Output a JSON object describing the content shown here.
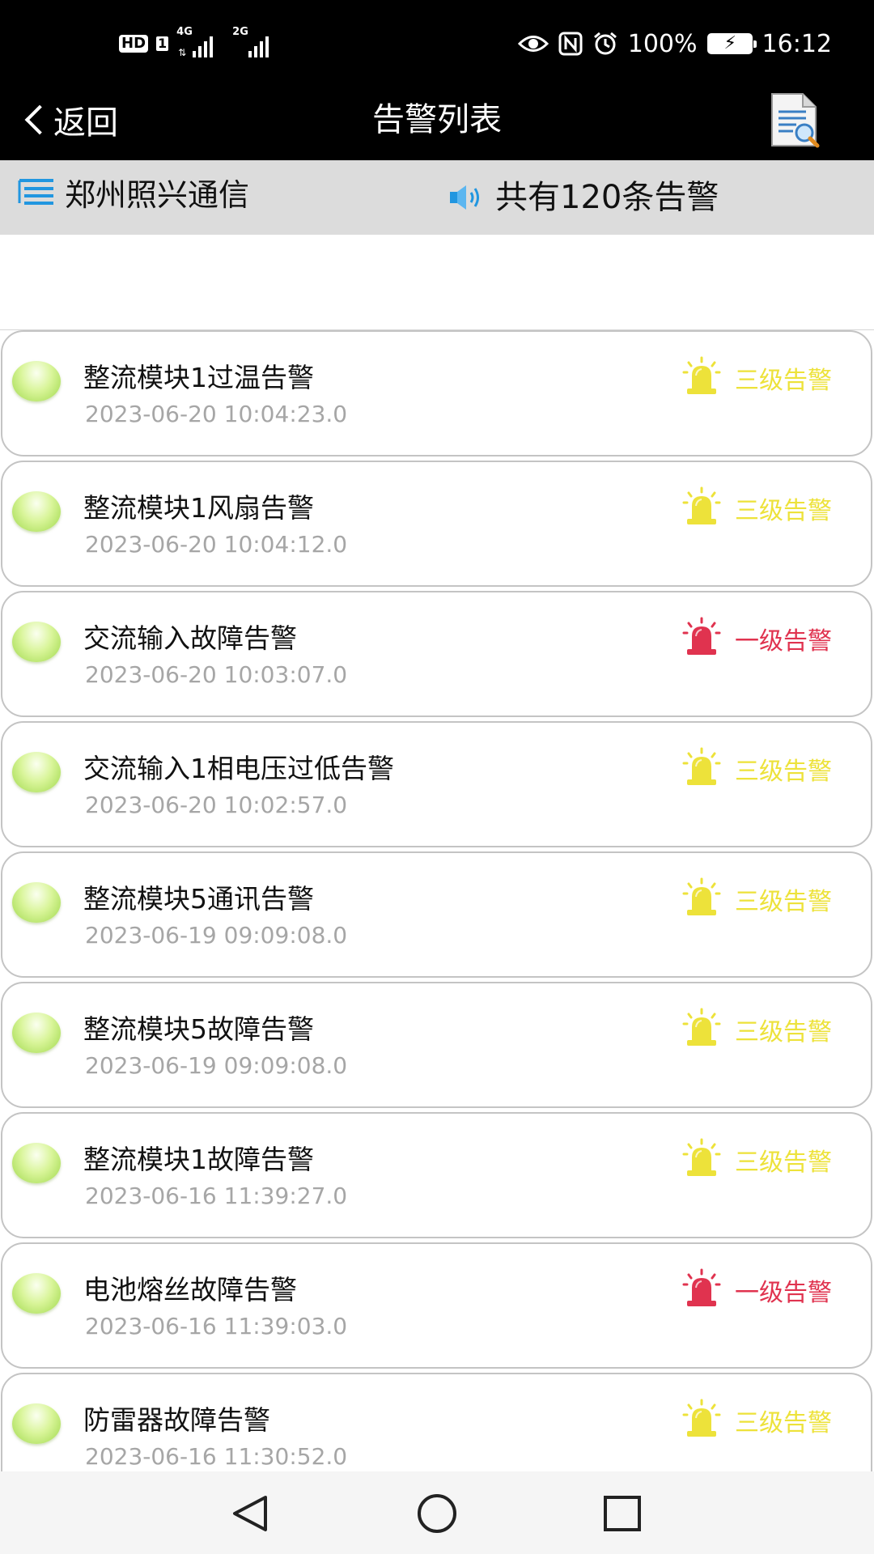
{
  "status_bar": {
    "hd": "HD",
    "sim": "1",
    "net1": "4G",
    "net2": "2G",
    "battery_percent": "100%",
    "time": "16:12"
  },
  "header": {
    "back_label": "返回",
    "title": "告警列表"
  },
  "info": {
    "station": "郑州照兴通信",
    "total": "共有120条告警"
  },
  "colors": {
    "level3": "#ede23a",
    "level1": "#e0334f"
  },
  "alarms": [
    {
      "name": "整流模块1过温告警",
      "time": "2023-06-20 10:04:23.0",
      "level": "三级告警",
      "severity": "level3"
    },
    {
      "name": "整流模块1风扇告警",
      "time": "2023-06-20 10:04:12.0",
      "level": "三级告警",
      "severity": "level3"
    },
    {
      "name": "交流输入故障告警",
      "time": "2023-06-20 10:03:07.0",
      "level": "一级告警",
      "severity": "level1"
    },
    {
      "name": "交流输入1相电压过低告警",
      "time": "2023-06-20 10:02:57.0",
      "level": "三级告警",
      "severity": "level3"
    },
    {
      "name": "整流模块5通讯告警",
      "time": "2023-06-19 09:09:08.0",
      "level": "三级告警",
      "severity": "level3"
    },
    {
      "name": "整流模块5故障告警",
      "time": "2023-06-19 09:09:08.0",
      "level": "三级告警",
      "severity": "level3"
    },
    {
      "name": "整流模块1故障告警",
      "time": "2023-06-16 11:39:27.0",
      "level": "三级告警",
      "severity": "level3"
    },
    {
      "name": "电池熔丝故障告警",
      "time": "2023-06-16 11:39:03.0",
      "level": "一级告警",
      "severity": "level1"
    },
    {
      "name": "防雷器故障告警",
      "time": "2023-06-16 11:30:52.0",
      "level": "三级告警",
      "severity": "level3"
    }
  ]
}
